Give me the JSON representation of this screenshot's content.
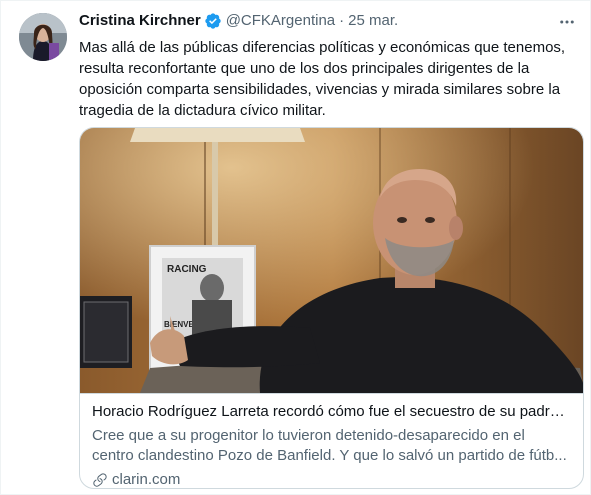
{
  "tweet": {
    "author_name": "Cristina Kirchner",
    "handle": "@CFKArgentina",
    "separator": "·",
    "date": "25 mar.",
    "text": "Mas allá de las públicas diferencias políticas y económicas que tenemos, resulta reconfortante que uno de los dos principales dirigentes de la oposición comparta sensibilidades, vivencias y mirada similares sobre la tragedia de la dictadura cívico militar."
  },
  "link_card": {
    "title": "Horacio Rodríguez Larreta recordó cómo fue el secuestro de su padre ...",
    "description_line1": "Cree que a su progenitor lo tuvieron detenido-desaparecido en el",
    "description_line2": "centro clandestino Pozo de Banfield. Y que lo salvó un partido de fútb...",
    "domain": "clarin.com",
    "poster_text_top": "RACING",
    "poster_text_bottom": "BIENVENIDO"
  },
  "icons": {
    "verified": "verified-badge-icon",
    "more": "more-dots-icon",
    "link": "link-icon"
  },
  "colors": {
    "verified_blue": "#1d9bf0",
    "secondary_text": "#536471",
    "border": "#cfd9de"
  }
}
